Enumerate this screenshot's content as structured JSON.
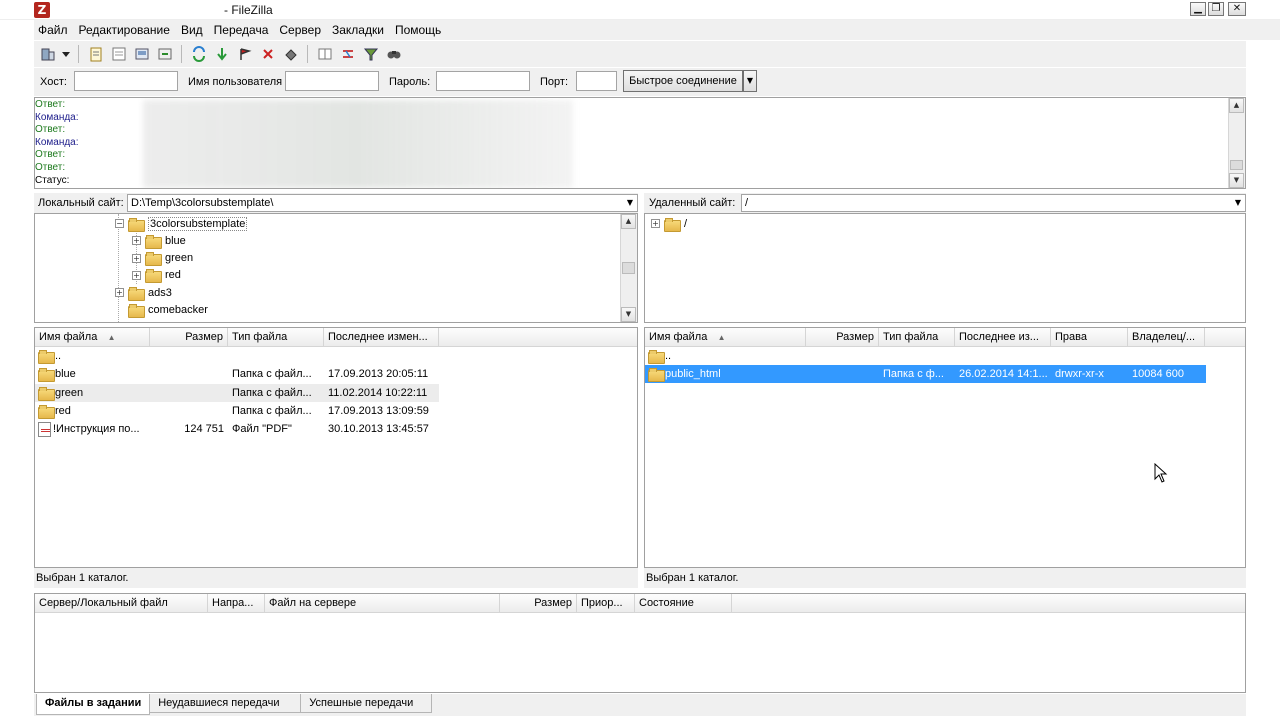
{
  "window": {
    "title": "- FileZilla",
    "icon_letter": "Z",
    "controls": {
      "minimize": "▁",
      "restore": "❐",
      "close": "✕"
    }
  },
  "menu": [
    "Файл",
    "Редактирование",
    "Вид",
    "Передача",
    "Сервер",
    "Закладки",
    "Помощь"
  ],
  "toolbar": {
    "icons": [
      "site-manager-icon",
      "dropdown-arrow-icon",
      "message-log-icon",
      "local-tree-icon",
      "remote-tree-icon",
      "queue-icon",
      "refresh-icon",
      "process-queue-icon",
      "cancel-icon",
      "disconnect-icon",
      "reconnect-icon",
      "directory-compare-icon",
      "sync-browse-icon",
      "filter-icon",
      "search-icon"
    ]
  },
  "quickconnect": {
    "host_label": "Хост:",
    "host_value": "",
    "user_label": "Имя пользователя",
    "user_value": "",
    "pass_label": "Пароль:",
    "pass_value": "",
    "port_label": "Порт:",
    "port_value": "",
    "button_label": "Быстрое соединение",
    "drop_glyph": "▼"
  },
  "log": [
    {
      "kind": "resp",
      "label": "Ответ:"
    },
    {
      "kind": "cmd",
      "label": "Команда:"
    },
    {
      "kind": "resp",
      "label": "Ответ:"
    },
    {
      "kind": "cmd",
      "label": "Команда:"
    },
    {
      "kind": "resp",
      "label": "Ответ:"
    },
    {
      "kind": "resp",
      "label": "Ответ:"
    },
    {
      "kind": "status",
      "label": "Статус:"
    }
  ],
  "local": {
    "site_label": "Локальный сайт:",
    "path": "D:\\Temp\\3colorsubstemplate\\",
    "tree": [
      {
        "name": "3colorsubstemplate",
        "indent": 0,
        "expander": "⊟",
        "selected_frame": true
      },
      {
        "name": "blue",
        "indent": 1,
        "expander": "+"
      },
      {
        "name": "green",
        "indent": 1,
        "expander": "+"
      },
      {
        "name": "red",
        "indent": 1,
        "expander": "+"
      },
      {
        "name": "ads3",
        "indent": -1,
        "expander": "+"
      },
      {
        "name": "comebacker",
        "indent": -1,
        "expander": ""
      }
    ],
    "columns": [
      "Имя файла",
      "Размер",
      "Тип файла",
      "Последнее измен..."
    ],
    "files": [
      {
        "name": "..",
        "size": "",
        "type": "",
        "modified": "",
        "icon": "folder"
      },
      {
        "name": "blue",
        "size": "",
        "type": "Папка с файл...",
        "modified": "17.09.2013 20:05:11",
        "icon": "folder"
      },
      {
        "name": "green",
        "size": "",
        "type": "Папка с файл...",
        "modified": "11.02.2014 10:22:11",
        "icon": "folder",
        "hover": true
      },
      {
        "name": "red",
        "size": "",
        "type": "Папка с файл...",
        "modified": "17.09.2013 13:09:59",
        "icon": "folder"
      },
      {
        "name": "!Инструкция по...",
        "size": "124 751",
        "type": "Файл \"PDF\"",
        "modified": "30.10.2013 13:45:57",
        "icon": "pdf"
      }
    ],
    "status": "Выбран 1 каталог."
  },
  "remote": {
    "site_label": "Удаленный сайт:",
    "path": "/",
    "tree": [
      {
        "name": "/",
        "expander": "+"
      }
    ],
    "columns": [
      "Имя файла",
      "Размер",
      "Тип файла",
      "Последнее из...",
      "Права",
      "Владелец/..."
    ],
    "files": [
      {
        "name": "..",
        "size": "",
        "type": "",
        "modified": "",
        "perms": "",
        "owner": "",
        "icon": "folder"
      },
      {
        "name": "public_html",
        "size": "",
        "type": "Папка с ф...",
        "modified": "26.02.2014 14:1...",
        "perms": "drwxr-xr-x",
        "owner": "10084 600",
        "icon": "folder",
        "selected": true
      }
    ],
    "status": "Выбран 1 каталог."
  },
  "queue": {
    "columns": [
      "Сервер/Локальный файл",
      "Напра...",
      "Файл на сервере",
      "Размер",
      "Приор...",
      "Состояние"
    ],
    "tabs": [
      "Файлы в задании",
      "Неудавшиеся передачи",
      "Успешные передачи"
    ]
  },
  "colors": {
    "selection": "#3399ff",
    "log_response": "#1e7a1e",
    "log_command": "#1c1c8a"
  }
}
